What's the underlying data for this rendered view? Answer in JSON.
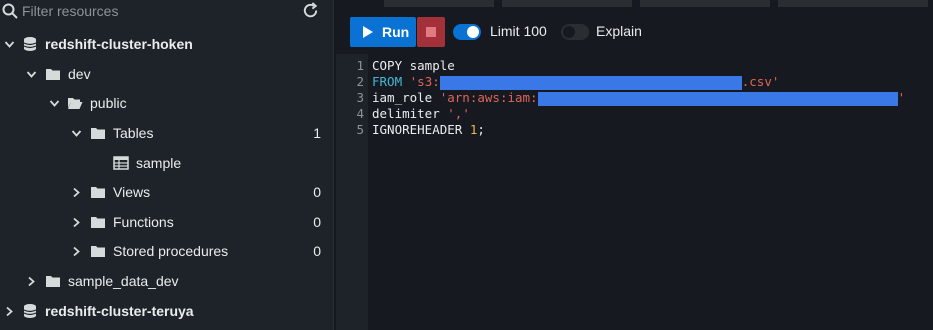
{
  "sidebar": {
    "search": {
      "placeholder": "Filter resources",
      "icon": "search-icon"
    },
    "refresh_icon": "refresh-icon",
    "tree": [
      {
        "label": "redshift-cluster-hoken",
        "icon": "database-icon",
        "expanded": true,
        "bold": true
      },
      {
        "label": "dev",
        "icon": "folder-icon",
        "expanded": true
      },
      {
        "label": "public",
        "icon": "folder-open-icon",
        "expanded": true
      },
      {
        "label": "Tables",
        "icon": "folder-icon",
        "expanded": true,
        "count": "1"
      },
      {
        "label": "sample",
        "icon": "table-icon"
      },
      {
        "label": "Views",
        "icon": "folder-icon",
        "expanded": false,
        "count": "0"
      },
      {
        "label": "Functions",
        "icon": "folder-icon",
        "expanded": false,
        "count": "0"
      },
      {
        "label": "Stored procedures",
        "icon": "folder-icon",
        "expanded": false,
        "count": "0"
      },
      {
        "label": "sample_data_dev",
        "icon": "folder-icon",
        "expanded": false
      },
      {
        "label": "redshift-cluster-teruya",
        "icon": "database-icon",
        "expanded": false,
        "bold": true
      }
    ]
  },
  "toolbar": {
    "run_label": "Run",
    "limit": {
      "label": "Limit 100",
      "on": true
    },
    "explain": {
      "label": "Explain",
      "on": false
    }
  },
  "editor": {
    "lines": [
      {
        "n": "1",
        "tokens": [
          {
            "t": "COPY sample",
            "c": "kw"
          }
        ]
      },
      {
        "n": "2",
        "tokens": [
          {
            "t": "FROM ",
            "c": "blue"
          },
          {
            "t": "'s3:",
            "c": "str"
          },
          {
            "t": "",
            "c": "redacted"
          },
          {
            "t": ".csv'",
            "c": "str"
          }
        ]
      },
      {
        "n": "3",
        "tokens": [
          {
            "t": "iam_role ",
            "c": "kw"
          },
          {
            "t": "'arn:aws:iam:",
            "c": "str"
          },
          {
            "t": "",
            "c": "redacted"
          },
          {
            "t": "'",
            "c": "str"
          }
        ]
      },
      {
        "n": "4",
        "tokens": [
          {
            "t": "delimiter ",
            "c": "kw"
          },
          {
            "t": "','",
            "c": "str"
          }
        ]
      },
      {
        "n": "5",
        "tokens": [
          {
            "t": "IGNOREHEADER ",
            "c": "kw"
          },
          {
            "t": "1",
            "c": "num"
          },
          {
            "t": ";",
            "c": "kw"
          }
        ]
      }
    ]
  },
  "colors": {
    "accent": "#0972d3",
    "stop": "#a4313a",
    "string": "#e0645a",
    "keyword_blue": "#44b9d6",
    "number": "#f0b35a",
    "redaction": "#3b78e7"
  }
}
